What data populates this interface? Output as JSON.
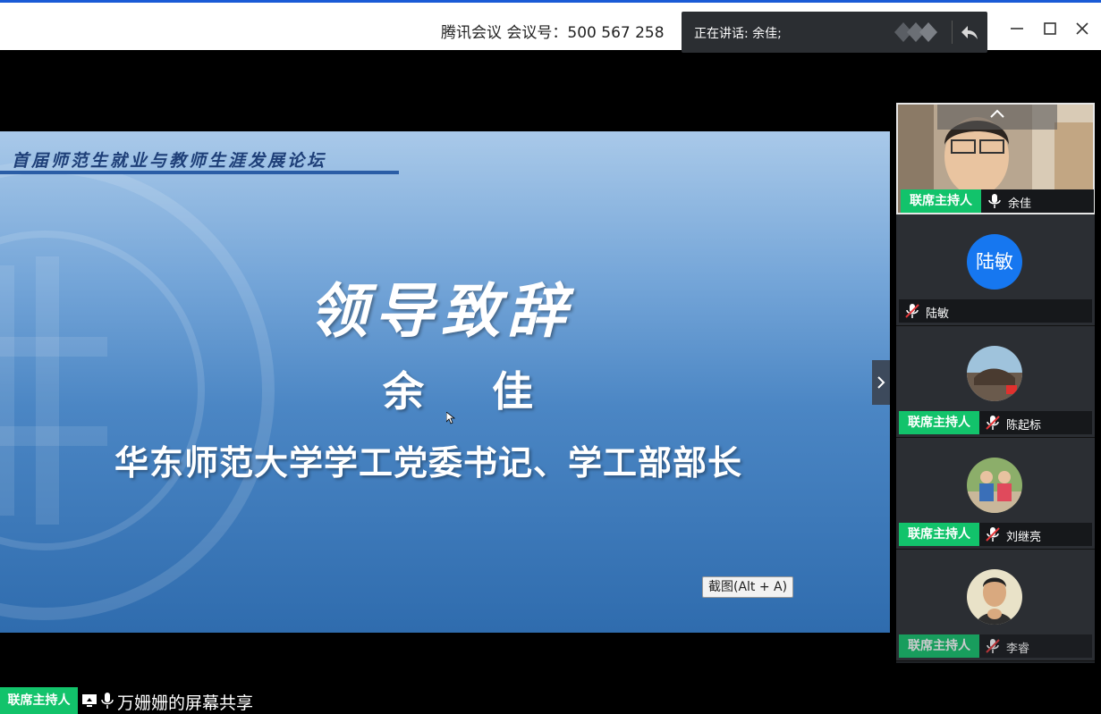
{
  "titlebar": {
    "meeting_info": "腾讯会议 会议号：500 567 258",
    "speaking_label": "正在讲话: 余佳;"
  },
  "slide": {
    "forum_title": "首届师范生就业与教师生涯发展论坛",
    "heading": "领导致辞",
    "speaker_name": "余 佳",
    "speaker_role": "华东师范大学学工党委书记、学工部部长"
  },
  "screenshot_tooltip": "截图(Alt + A)",
  "participants": [
    {
      "name": "余佳",
      "role_badge": "联席主持人",
      "mic": "on",
      "avatar": "video"
    },
    {
      "name": "陆敏",
      "role_badge": "",
      "mic": "muted",
      "avatar": "letters",
      "avatar_text": "陆敏",
      "avatar_color": "#1677f0"
    },
    {
      "name": "陈起标",
      "role_badge": "联席主持人",
      "mic": "muted",
      "avatar": "photo"
    },
    {
      "name": "刘继亮",
      "role_badge": "联席主持人",
      "mic": "muted",
      "avatar": "photo"
    },
    {
      "name": "李睿",
      "role_badge": "联席主持人",
      "mic": "muted",
      "avatar": "photo"
    }
  ],
  "share_bar": {
    "role_badge": "联席主持人",
    "text": "万姗姗的屏幕共享"
  },
  "colors": {
    "cohost_badge": "#12c36b",
    "title_accent": "#1a5bd6",
    "avatar_blue": "#1677f0"
  }
}
